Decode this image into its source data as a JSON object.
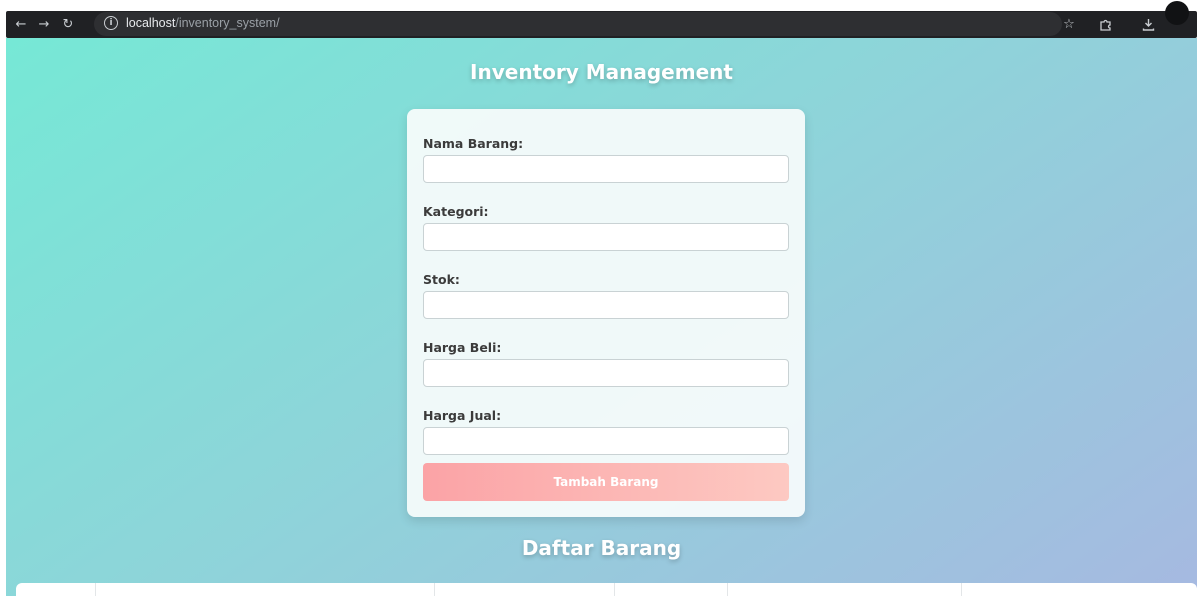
{
  "browser": {
    "url_host": "localhost",
    "url_path": "/inventory_system/",
    "icons": {
      "back": "back-arrow-icon",
      "forward": "forward-arrow-icon",
      "reload": "reload-icon",
      "info": "site-info-icon",
      "bookmark": "bookmark-star-icon",
      "extensions": "extensions-puzzle-icon",
      "downloads": "download-icon",
      "profile": "profile-avatar"
    }
  },
  "page": {
    "title": "Inventory Management",
    "list_title": "Daftar Barang"
  },
  "form": {
    "fields": [
      {
        "label": "Nama Barang:",
        "value": ""
      },
      {
        "label": "Kategori:",
        "value": ""
      },
      {
        "label": "Stok:",
        "value": ""
      },
      {
        "label": "Harga Beli:",
        "value": ""
      },
      {
        "label": "Harga Jual:",
        "value": ""
      }
    ],
    "submit_label": "Tambah Barang"
  },
  "colors": {
    "gradient_start": "#76e8d6",
    "gradient_end": "#a6b9e1",
    "button_start": "#fba3a6",
    "button_end": "#fdc9c2"
  }
}
